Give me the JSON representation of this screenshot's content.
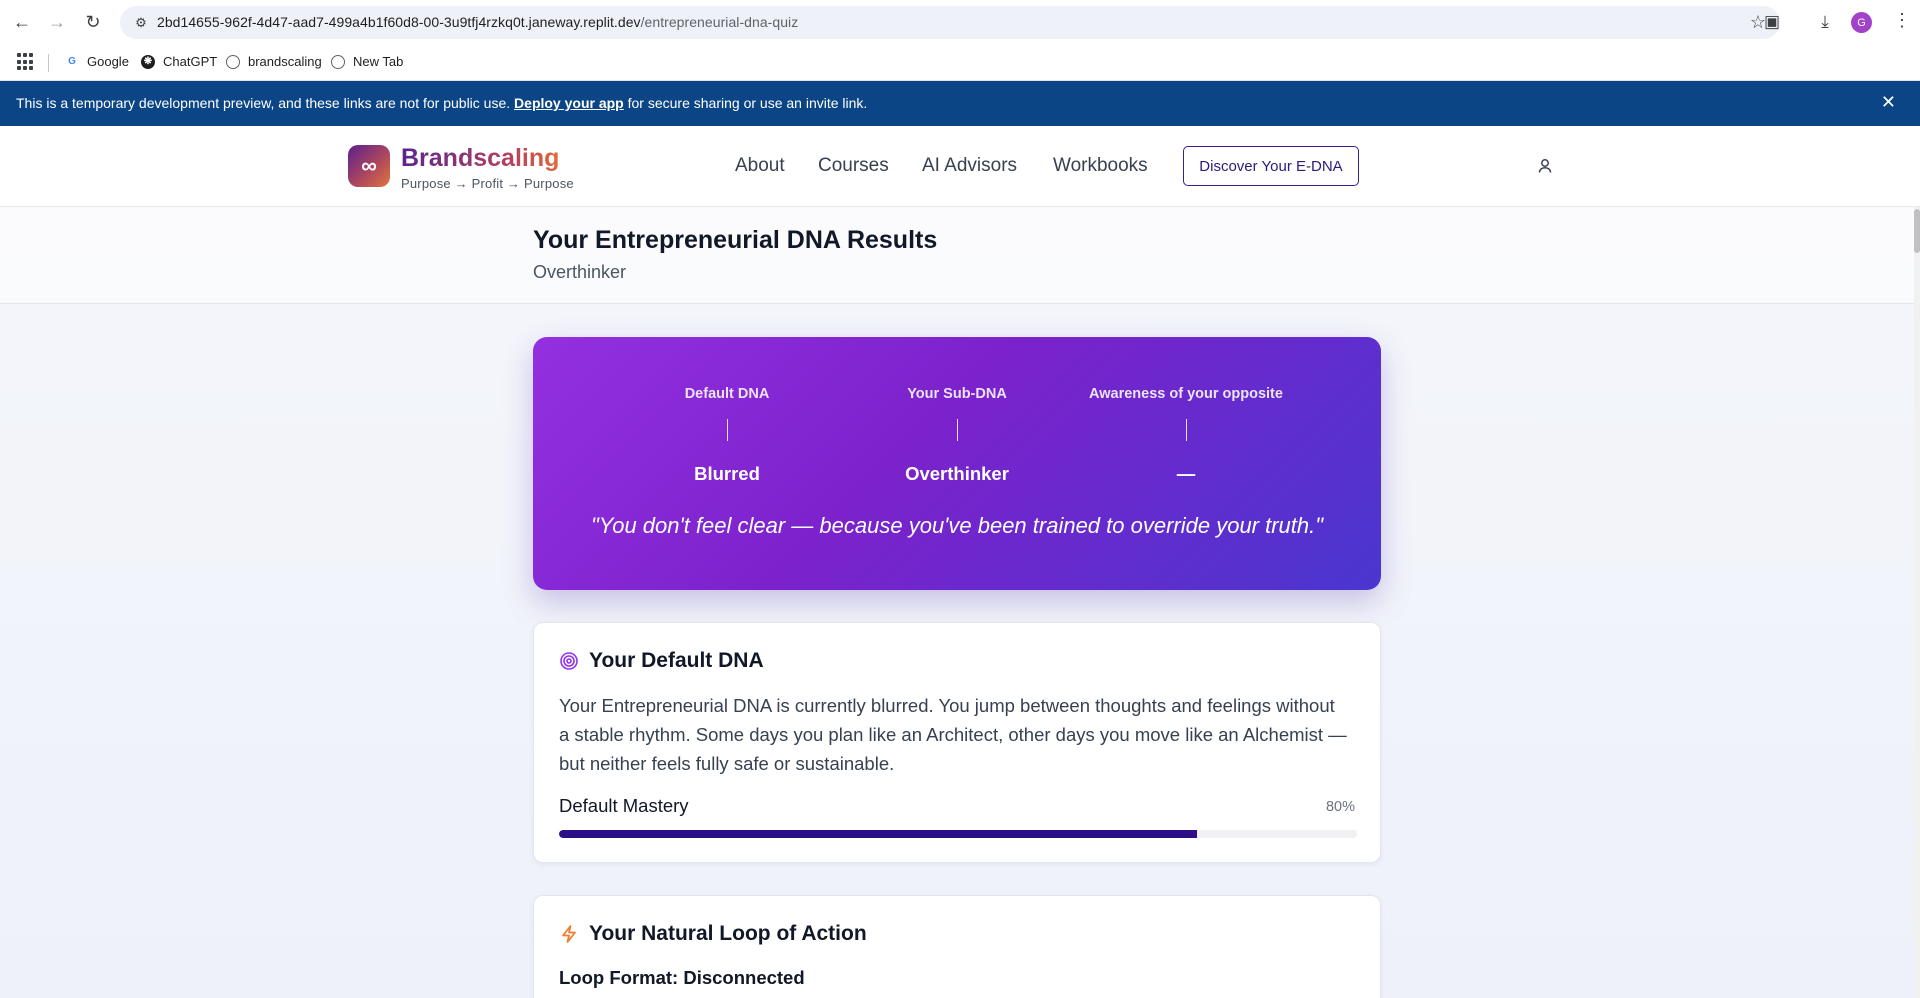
{
  "browser": {
    "url_host": "2bd14655-962f-4d47-aad7-499a4b1f60d8-00-3u9tfj4rzkq0t.janeway.replit.dev",
    "url_path": "/entrepreneurial-dna-quiz",
    "profile_initial": "G"
  },
  "bookmarks": [
    {
      "label": "Google"
    },
    {
      "label": "ChatGPT"
    },
    {
      "label": "brandscaling"
    },
    {
      "label": "New Tab"
    }
  ],
  "dev_banner": {
    "text_before": "This is a temporary development preview, and these links are not for public use. ",
    "link": "Deploy your app",
    "text_after": " for secure sharing or use an invite link."
  },
  "header": {
    "logo_symbol": "∞",
    "brand": "Brandscaling",
    "tagline": "Purpose → Profit → Purpose",
    "nav": [
      "About",
      "Courses",
      "AI Advisors",
      "Workbooks"
    ],
    "cta": "Discover Your E-DNA"
  },
  "page": {
    "title": "Your Entrepreneurial DNA Results",
    "subtitle": "Overthinker"
  },
  "hero": {
    "columns": [
      {
        "label": "Default DNA",
        "value": "Blurred"
      },
      {
        "label": "Your Sub-DNA",
        "value": "Overthinker"
      },
      {
        "label": "Awareness of your opposite",
        "value": "—"
      }
    ],
    "quote": "\"You don't feel clear — because you've been trained to override your truth.\""
  },
  "default_dna_card": {
    "title": "Your Default DNA",
    "body": "Your Entrepreneurial DNA is currently blurred. You jump between thoughts and feelings without a stable rhythm. Some days you plan like an Architect, other days you move like an Alchemist — but neither feels fully safe or sustainable.",
    "mastery_label": "Default Mastery",
    "mastery_pct_text": "80%",
    "mastery_value": 0.8
  },
  "loop_card": {
    "title": "Your Natural Loop of Action",
    "format": "Loop Format: Disconnected"
  },
  "colors": {
    "banner": "#0b4585",
    "hero_start": "#9330e0",
    "hero_end": "#4a36cf",
    "progress_fill": "#2c0e86",
    "accent_orange": "#f07b2a"
  }
}
